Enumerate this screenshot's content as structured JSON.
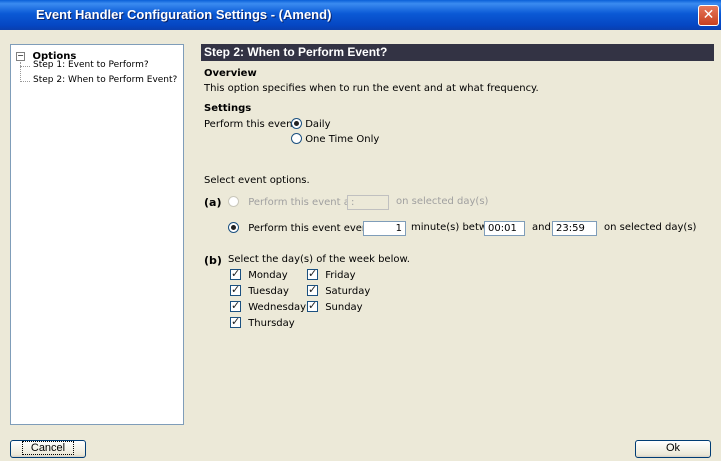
{
  "window": {
    "title": "Event Handler Configuration Settings - (Amend)",
    "close_glyph": "✕"
  },
  "tree": {
    "root_label": "Options",
    "expander_glyph": "−",
    "items": [
      {
        "label": "Step 1: Event to Perform?"
      },
      {
        "label": "Step 2: When to Perform Event?"
      }
    ]
  },
  "content": {
    "step_title": "Step 2: When to Perform Event?",
    "overview_heading": "Overview",
    "overview_text": "This option specifies when to run the event and at what frequency.",
    "settings_heading": "Settings",
    "perform_label": "Perform this event:",
    "frequency_options": [
      {
        "label": "Daily",
        "selected": true
      },
      {
        "label": "One Time Only",
        "selected": false
      }
    ],
    "select_options_label": "Select event options.",
    "option_a": {
      "marker": "(a)",
      "at_label": "Perform this event at",
      "at_value": ":",
      "at_suffix": "on selected day(s)",
      "every_label": "Perform this event every",
      "every_value": "1",
      "between_label": "minute(s) between",
      "start_time": "00:01",
      "and_label": "and",
      "end_time": "23:59",
      "every_suffix": "on selected day(s)"
    },
    "option_b": {
      "marker": "(b)",
      "label": "Select the day(s) of the week below.",
      "days": [
        {
          "label": "Monday",
          "checked": true
        },
        {
          "label": "Tuesday",
          "checked": true
        },
        {
          "label": "Wednesday",
          "checked": true
        },
        {
          "label": "Thursday",
          "checked": true
        },
        {
          "label": "Friday",
          "checked": true
        },
        {
          "label": "Saturday",
          "checked": true
        },
        {
          "label": "Sunday",
          "checked": true
        }
      ]
    }
  },
  "footer": {
    "cancel_label": "Cancel",
    "ok_label": "Ok"
  }
}
